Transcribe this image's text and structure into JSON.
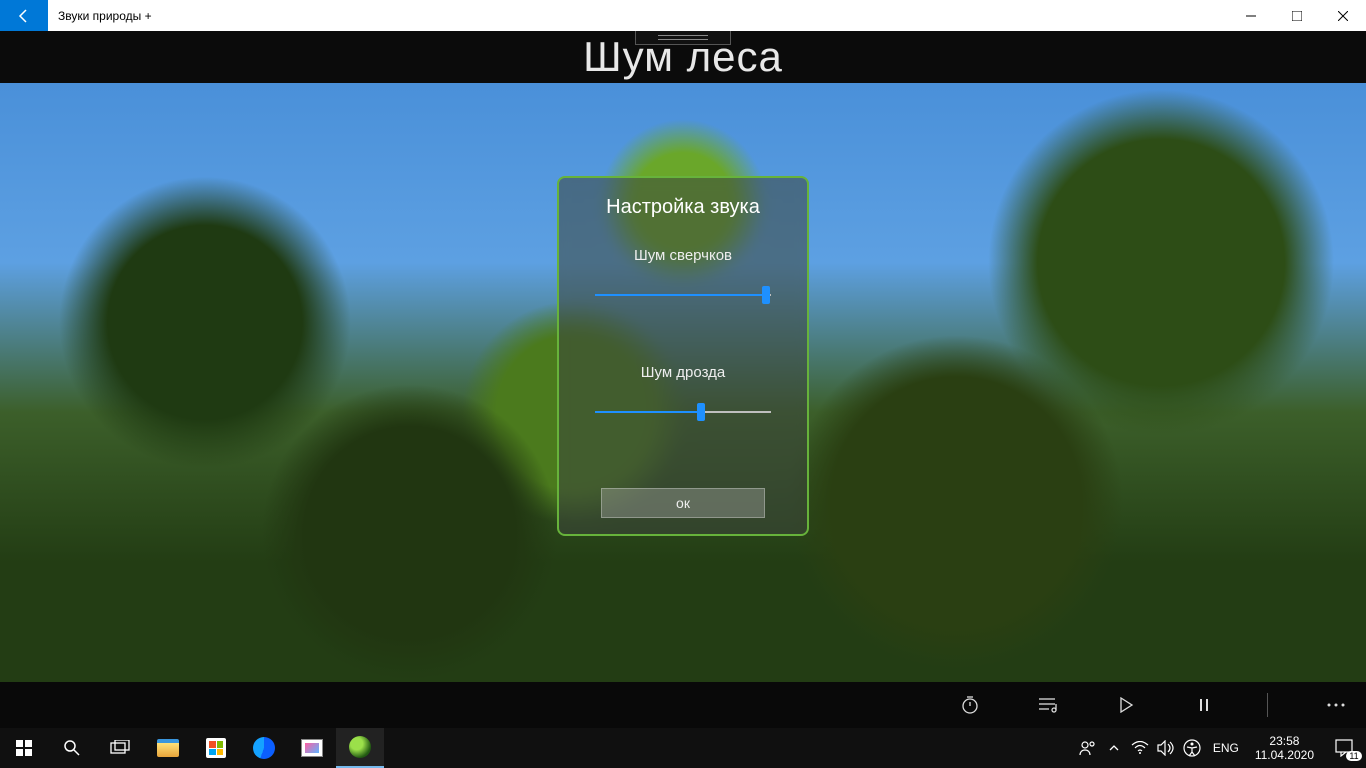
{
  "titlebar": {
    "app_title": "Звуки природы +"
  },
  "header": {
    "page_title": "Шум леса"
  },
  "dialog": {
    "title": "Настройка звука",
    "sounds": [
      {
        "label": "Шум сверчков",
        "value": 97
      },
      {
        "label": "Шум  дрозда",
        "value": 60
      }
    ],
    "ok_label": "ок"
  },
  "bottombar": {
    "icons": [
      "timer",
      "playlist",
      "play",
      "pause",
      "more"
    ]
  },
  "taskbar": {
    "lang": "ENG",
    "time": "23:58",
    "date": "11.04.2020",
    "notif_count": "11"
  }
}
